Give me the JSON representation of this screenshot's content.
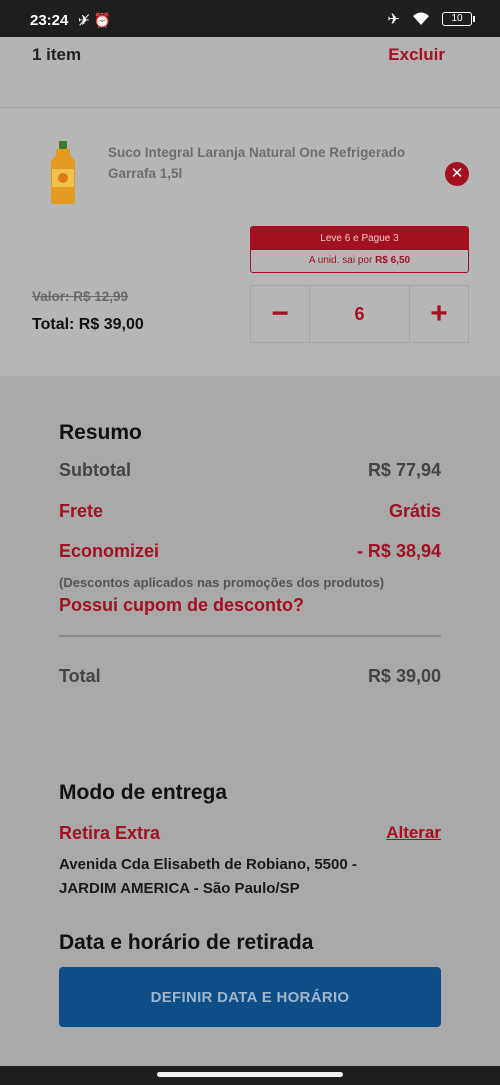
{
  "status_bar": {
    "time": "23:24",
    "left_icons": "✈̸ ⏰",
    "battery": "10"
  },
  "cart": {
    "items_count": "1 item",
    "delete_label": "Excluir"
  },
  "product": {
    "name": "Suco Integral Laranja Natural One Refrigerado Garrafa 1,5l",
    "promo_title": "Leve 6 e Pague 3",
    "promo_unit_prefix": "A unid. sai por ",
    "promo_unit_price": "R$ 6,50",
    "old_price": "Valor: R$ 12,99",
    "total": "Total: R$ 39,00",
    "quantity": "6",
    "minus": "−",
    "plus": "+",
    "remove_symbol": "✕"
  },
  "summary": {
    "title": "Resumo",
    "subtotal_label": "Subtotal",
    "subtotal_value": "R$ 77,94",
    "shipping_label": "Frete",
    "shipping_value": "Grátis",
    "saved_label": "Economizei",
    "saved_value": "- R$ 38,94",
    "discount_note": "(Descontos aplicados nas promoções dos produtos)",
    "coupon_link": "Possui cupom de desconto?",
    "total_label": "Total",
    "total_value": "R$ 39,00"
  },
  "delivery": {
    "title": "Modo de entrega",
    "mode": "Retira Extra",
    "change_label": "Alterar",
    "address_line1": "Avenida Cda Elisabeth de Robiano, 5500 -",
    "address_line2": "JARDIM AMERICA - São Paulo/SP",
    "pickup_title": "Data e horário de retirada",
    "cta_label": "DEFINIR DATA E HORÁRIO"
  },
  "colors": {
    "accent_red": "#a31022",
    "cta_blue": "#0d4e89"
  }
}
